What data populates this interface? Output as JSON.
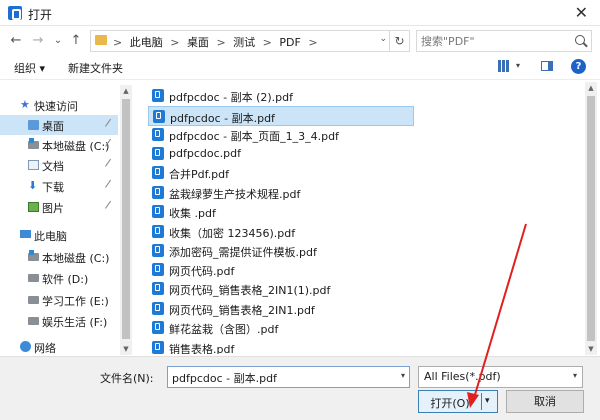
{
  "window": {
    "title": "打开",
    "close_glyph": "✕"
  },
  "nav": {
    "back": "←",
    "forward": "→",
    "dropdown": "⌄",
    "up": "↑"
  },
  "address": {
    "crumbs": [
      "此电脑",
      "桌面",
      "测试",
      "PDF"
    ],
    "separator": ">",
    "dropdown": "⌄",
    "refresh": "↻"
  },
  "search": {
    "placeholder": "搜索\"PDF\""
  },
  "toolbar": {
    "organize": "组织 ▾",
    "new_folder": "新建文件夹",
    "view_dropdown": "▾",
    "help": "?"
  },
  "sidebar": {
    "items": [
      {
        "label": "快速访问",
        "icon": "star-icon"
      },
      {
        "label": "桌面",
        "icon": "folder-icon",
        "selected": true,
        "pinned": true
      },
      {
        "label": "本地磁盘 (C:)",
        "icon": "drive-icon",
        "pinned": true
      },
      {
        "label": "文档",
        "icon": "document-icon",
        "pinned": true
      },
      {
        "label": "下载",
        "icon": "download-icon",
        "pinned": true
      },
      {
        "label": "图片",
        "icon": "picture-icon",
        "pinned": true
      },
      {
        "label": "此电脑",
        "icon": "computer-icon"
      },
      {
        "label": "本地磁盘 (C:)",
        "icon": "drive-icon"
      },
      {
        "label": "软件 (D:)",
        "icon": "drive-icon"
      },
      {
        "label": "学习工作 (E:)",
        "icon": "drive-icon"
      },
      {
        "label": "娱乐生活 (F:)",
        "icon": "drive-icon"
      },
      {
        "label": "网络",
        "icon": "network-icon"
      }
    ]
  },
  "files": [
    {
      "name": "pdfpcdoc - 副本 (2).pdf"
    },
    {
      "name": "pdfpcdoc - 副本.pdf",
      "selected": true
    },
    {
      "name": "pdfpcdoc - 副本_页面_1_3_4.pdf"
    },
    {
      "name": "pdfpcdoc.pdf"
    },
    {
      "name": "合并Pdf.pdf"
    },
    {
      "name": "盆栽绿萝生产技术规程.pdf"
    },
    {
      "name": "收集 .pdf"
    },
    {
      "name": "收集（加密 123456).pdf"
    },
    {
      "name": "添加密码_需提供证件模板.pdf"
    },
    {
      "name": "网页代码.pdf"
    },
    {
      "name": "网页代码_销售表格_2IN1(1).pdf"
    },
    {
      "name": "网页代码_销售表格_2IN1.pdf"
    },
    {
      "name": "鲜花盆栽（含图）.pdf"
    },
    {
      "name": "销售表格.pdf"
    }
  ],
  "bottom": {
    "filename_label": "文件名(N):",
    "filename_value": "pdfpcdoc - 副本.pdf",
    "filetype_value": "All Files(*.pdf)",
    "open_label": "打开(O)",
    "cancel_label": "取消",
    "dropdown": "▾"
  },
  "colors": {
    "selection": "#cce4f7",
    "accent": "#1f7ad6",
    "annotation_arrow": "#e02020"
  }
}
